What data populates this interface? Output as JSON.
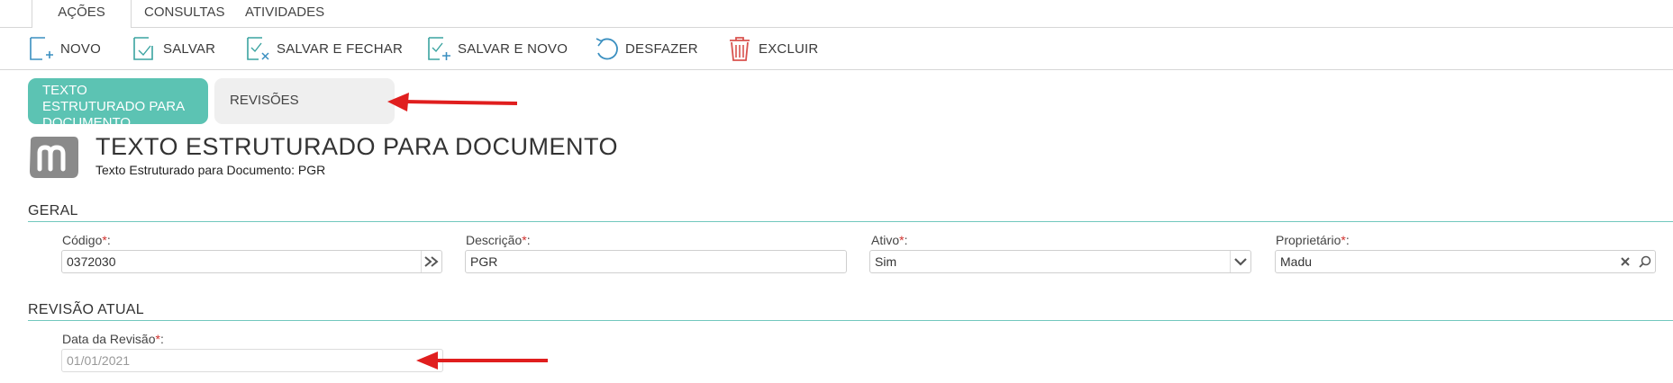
{
  "menu": {
    "tabs": [
      "AÇÕES",
      "CONSULTAS",
      "ATIVIDADES"
    ]
  },
  "toolbar": {
    "novo": "NOVO",
    "salvar": "SALVAR",
    "salvar_fechar": "SALVAR E FECHAR",
    "salvar_novo": "SALVAR E NOVO",
    "desfazer": "DESFAZER",
    "excluir": "EXCLUIR",
    "icon_color": "#3aa3a0",
    "delete_color": "#d9534f"
  },
  "tabs": {
    "active": "TEXTO ESTRUTURADO PARA DOCUMENTO",
    "inactive": "REVISÕES"
  },
  "header": {
    "title": "TEXTO ESTRUTURADO PARA DOCUMENTO",
    "subtitle": "Texto Estruturado para Documento: PGR"
  },
  "geral": {
    "section_title": "GERAL",
    "codigo": {
      "label": "Código",
      "value": "0372030"
    },
    "descricao": {
      "label": "Descrição",
      "value": "PGR"
    },
    "ativo": {
      "label": "Ativo",
      "value": "Sim"
    },
    "proprietario": {
      "label": "Proprietário",
      "value": "Madu"
    }
  },
  "revisao": {
    "section_title": "REVISÃO ATUAL",
    "data": {
      "label": "Data da Revisão",
      "value": "01/01/2021"
    }
  },
  "required_mark": "*",
  "label_colon": ":",
  "accent": "#5cc3b3",
  "arrow_color": "#e01e1e"
}
